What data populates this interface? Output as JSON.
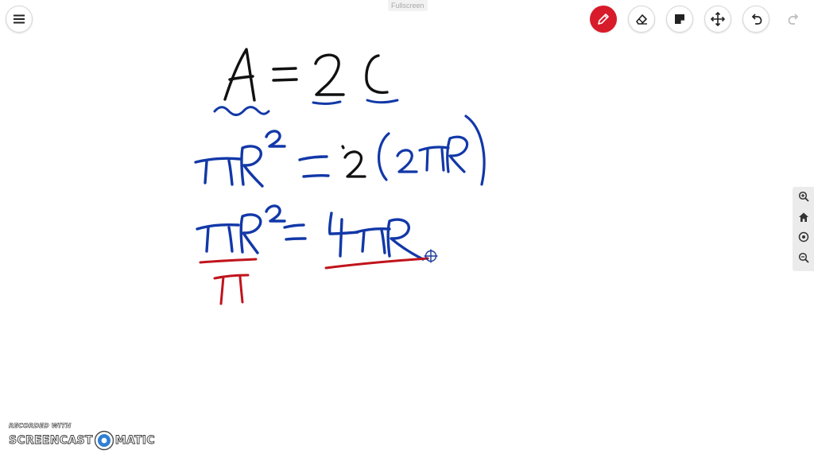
{
  "app": {
    "fullscreen_label": "Fullscreen"
  },
  "toolbar": {
    "menu_icon": "hamburger-menu-icon",
    "tools": [
      {
        "name": "pen",
        "icon": "pencil-icon",
        "active": true
      },
      {
        "name": "eraser",
        "icon": "eraser-icon",
        "active": false
      },
      {
        "name": "sticky-note",
        "icon": "sticky-note-icon",
        "active": false
      },
      {
        "name": "move",
        "icon": "move-arrows-icon",
        "active": false
      },
      {
        "name": "undo",
        "icon": "undo-arrow-icon",
        "active": false
      },
      {
        "name": "redo",
        "icon": "redo-arrow-icon",
        "active": false,
        "disabled": true
      }
    ]
  },
  "zoom_controls": [
    {
      "name": "zoom-in",
      "icon": "zoom-in-icon"
    },
    {
      "name": "home",
      "icon": "home-icon"
    },
    {
      "name": "recenter",
      "icon": "target-icon"
    },
    {
      "name": "zoom-out",
      "icon": "zoom-out-icon"
    }
  ],
  "colors": {
    "accent_active": "#d81b2a",
    "ink_black": "#111111",
    "ink_blue": "#1238a8",
    "ink_red": "#c0141c",
    "icon_gray": "#222222",
    "disabled_gray": "#bdbdbd"
  },
  "watermark": {
    "line1": "RECORDED WITH",
    "word1": "SCREENCAST",
    "word2": "MATIC"
  }
}
